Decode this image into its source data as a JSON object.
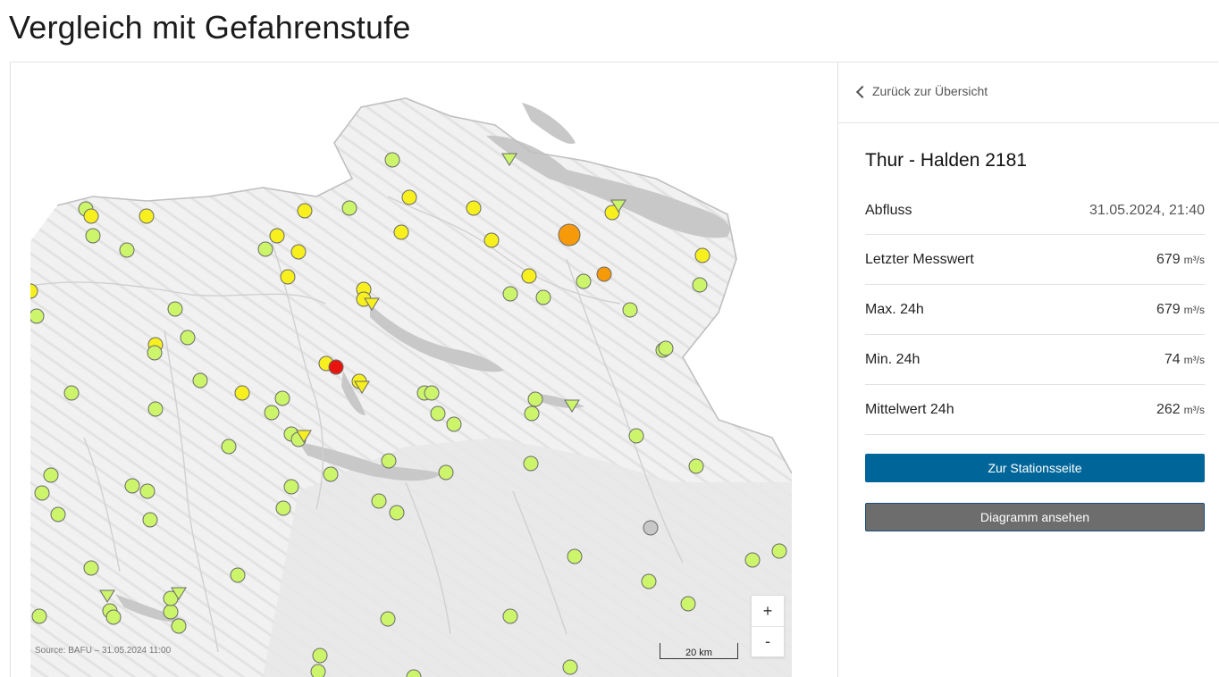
{
  "page": {
    "title": "Vergleich mit Gefahrenstufe"
  },
  "map": {
    "source": "Source: BAFU – 31.05.2024 11:00",
    "scale_label": "20 km",
    "zoom_in": "+",
    "zoom_out": "-",
    "colors": {
      "lake": "#c8c8c8",
      "level1": "#ccf56b",
      "level2": "#f7f01e",
      "level3": "#f79a0a",
      "level4": "#e8140e",
      "nodata": "#c8c8c8"
    }
  },
  "panel": {
    "back_label": "Zurück zur Übersicht",
    "station": "Thur - Halden 2181",
    "rows": [
      {
        "label": "Abfluss",
        "value": "31.05.2024, 21:40",
        "unit": ""
      },
      {
        "label": "Letzter Messwert",
        "value": "679",
        "unit": "m³/s"
      },
      {
        "label": "Max. 24h",
        "value": "679",
        "unit": "m³/s"
      },
      {
        "label": "Min. 24h",
        "value": "74",
        "unit": "m³/s"
      },
      {
        "label": "Mittelwert 24h",
        "value": "262",
        "unit": "m³/s"
      }
    ],
    "button_station": "Zur Stationsseite",
    "button_diagram": "Diagramm ansehen"
  }
}
